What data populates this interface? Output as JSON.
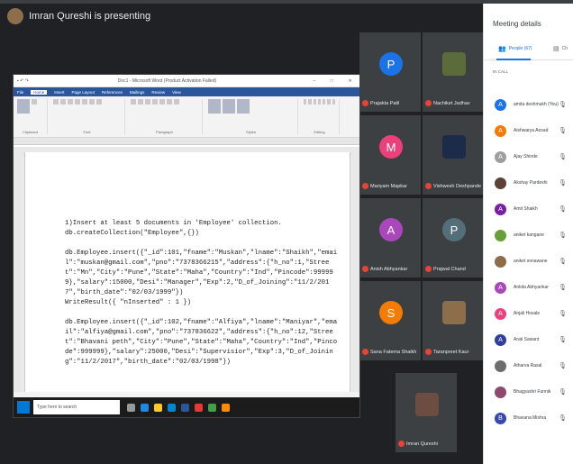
{
  "presenting": {
    "text": "Imran Qureshi is presenting"
  },
  "word": {
    "title": "Doc1 - Microsoft Word (Product Activation Failed)",
    "menu": [
      "File",
      "Home",
      "Insert",
      "Page Layout",
      "References",
      "Mailings",
      "Review",
      "View"
    ],
    "groups": [
      "Clipboard",
      "Font",
      "Paragraph",
      "Styles",
      "Editing"
    ],
    "doc_lines": [
      "1)Insert at least 5 documents in 'Employee' collection.",
      "db.createCollection(\"Employee\",{})",
      "",
      "db.Employee.insert({\"_id\":101,\"fname\":\"Muskan\",\"lname\":\"Shaikh\",\"email\":\"muskan@gmail.com\",\"pno\":\"7378366215\",\"address\":{\"h_no\":1,\"Street\":\"Mn\",\"City\":\"Pune\",\"State\":\"Maha\",\"Country\":\"Ind\",\"Pincode\":999999},\"salary\":15000,\"Desi\":\"Manager\",\"Exp\":2,\"D_of_Joining\":\"11/2/2017\",\"birth_date\":\"02/03/1999\"})",
      "WriteResult({ \"nInserted\" : 1 })",
      "",
      "db.Employee.insert({\"_id\":102,\"fname\":\"Alfiya\",\"lname\":\"Maniyar\",\"email\":\"alfiya@gmail.com\",\"pno\":\"737836622\",\"address\":{\"h_no\":12,\"Street\":\"Bhavani peth\",\"City\":\"Pune\",\"State\":\"Maha\",\"Country\":\"Ind\",\"Pincode\":999999},\"salary\":25000,\"Desi\":\"Supervisior\",\"Exp\":3,\"D_of_Joining\":\"11/2/2017\",\"birth_date\":\"02/03/1998\"})"
    ],
    "search_placeholder": "Type here to search"
  },
  "tiles": [
    {
      "name": "Prajakta Patil",
      "initial": "P",
      "color": "#1a73e8"
    },
    {
      "name": "Nachiket Jadhav",
      "initial": "",
      "color": "#5b6b3a"
    },
    {
      "name": "Mariyam Mapkar",
      "initial": "M",
      "color": "#ec407a"
    },
    {
      "name": "Vishwesh Deshpande",
      "initial": "",
      "color": "#1c2b4a"
    },
    {
      "name": "Anish Abhyankar",
      "initial": "A",
      "color": "#ab47bc"
    },
    {
      "name": "Prajwal Chand",
      "initial": "P",
      "color": "#546e7a"
    },
    {
      "name": "Sana Fatema Shaikh",
      "initial": "S",
      "color": "#f57c00"
    },
    {
      "name": "Taranpreet Kaur",
      "initial": "",
      "color": "#8d6e4a"
    },
    {
      "name": "Imran Qureshi",
      "initial": "",
      "color": "#6d4c41"
    }
  ],
  "panel": {
    "title": "Meeting details",
    "tab_people": "People (67)",
    "tab_chat": "Ch",
    "in_call": "IN CALL",
    "people": [
      {
        "name": "amita deshmukh (You)",
        "initial": "A",
        "color": "#1a73e8"
      },
      {
        "name": "Aishwarya Aosad",
        "initial": "A",
        "color": "#f57c00"
      },
      {
        "name": "Ajay Shinde",
        "initial": "A",
        "color": "#9e9e9e"
      },
      {
        "name": "Akshay Pardeshi",
        "initial": "",
        "color": "#5d4037"
      },
      {
        "name": "Amit Shaikh",
        "initial": "A",
        "color": "#7b1fa2"
      },
      {
        "name": "aniket kangane",
        "initial": "",
        "color": "#689f38"
      },
      {
        "name": "aniket sonawane",
        "initial": "",
        "color": "#8e6c4a"
      },
      {
        "name": "Ankita Abhyankar",
        "initial": "A",
        "color": "#ab47bc"
      },
      {
        "name": "Anjali Hosale",
        "initial": "A",
        "color": "#ec407a"
      },
      {
        "name": "Arati Sawant",
        "initial": "A",
        "color": "#303f9f"
      },
      {
        "name": "Atharva Rasal",
        "initial": "",
        "color": "#6d6d6d"
      },
      {
        "name": "Bhagyashri Funnik",
        "initial": "",
        "color": "#8d4a6e"
      },
      {
        "name": "Bhavana Mishra",
        "initial": "B",
        "color": "#3949ab"
      }
    ]
  }
}
